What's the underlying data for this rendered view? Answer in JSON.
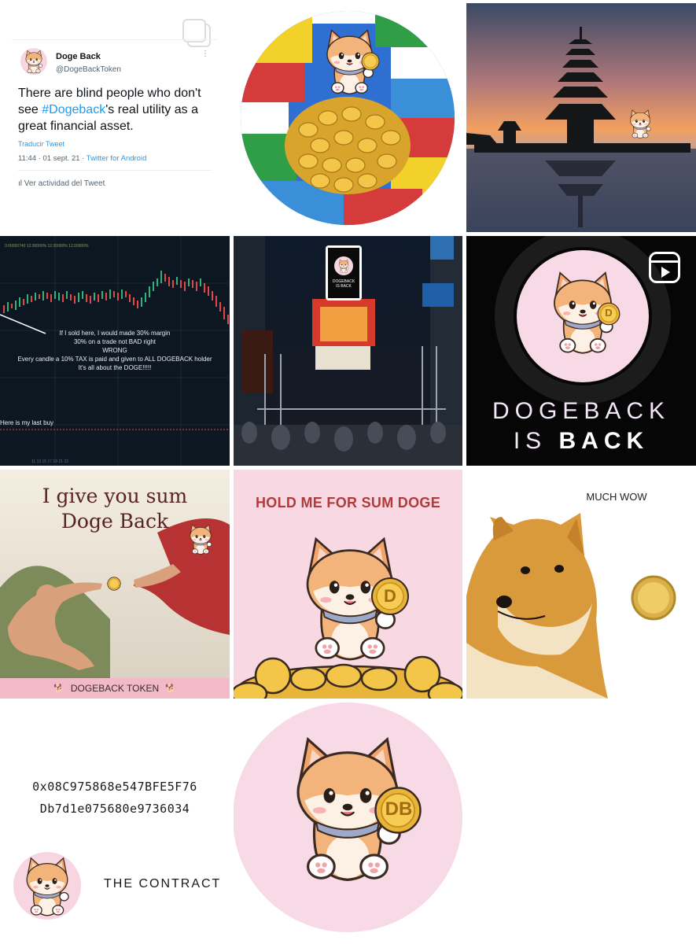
{
  "tweet": {
    "name": "Doge Back",
    "handle": "@DogeBackToken",
    "text_before": "There are blind people who don't see ",
    "hashtag": "#Dogeback",
    "text_after": "'s real utility as a great financial asset.",
    "translate": "Traducir Tweet",
    "time": "11:44 · 01 sept. 21 · ",
    "source": "Twitter for Android",
    "activity": "Ver actividad del Tweet"
  },
  "chart_post": {
    "line1": "If I sold here, I would made 30% margin",
    "line2": "30% on a trade not BAD right",
    "line3": "WRONG",
    "line4": "Every candle a 10% TAX is paid and given to ALL DOGEBACK holder",
    "line5": "It's all about the DOGE!!!!!",
    "note": "Here is my last buy"
  },
  "times_square": {
    "sign_line1": "DOGEBACK",
    "sign_line2": "IS BACK"
  },
  "reel": {
    "line1": "DOGEBACK",
    "line2_a": "IS",
    "line2_b": "BACK",
    "coin_label": "D"
  },
  "creation": {
    "title_line1": "I give you sum",
    "title_line2": "Doge Back",
    "footer": "DOGEBACK TOKEN"
  },
  "hold": {
    "title": "HOLD ME FOR SUM DOGE",
    "coin_label": "D"
  },
  "much_wow": {
    "title": "MUCH WOW"
  },
  "contract": {
    "address_line1": "0x08C975868e547BFE5F76",
    "address_line2": "Db7d1e075680e9736034",
    "label": "THE CONTRACT"
  },
  "logo": {
    "coin_label": "DB"
  },
  "colors": {
    "twitter_blue": "#1d9bf0",
    "pink": "#f8d9e3",
    "coin_gold": "#e9b43a",
    "shiba_orange": "#f3b47c"
  }
}
